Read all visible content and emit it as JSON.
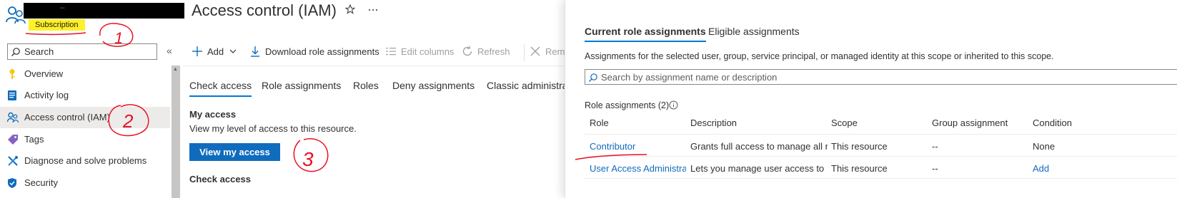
{
  "header": {
    "title": "Access control (IAM)",
    "redacted_text": "--",
    "resource_type": "Subscription",
    "favorite_icon": "star-icon",
    "more_icon": "ellipsis-icon"
  },
  "sidebar": {
    "search_placeholder": "Search",
    "collapse_glyph": "«",
    "items": [
      {
        "label": "Overview",
        "icon": "key-icon"
      },
      {
        "label": "Activity log",
        "icon": "activity-log-icon"
      },
      {
        "label": "Access control (IAM)",
        "icon": "people-icon",
        "active": true
      },
      {
        "label": "Tags",
        "icon": "tag-icon"
      },
      {
        "label": "Diagnose and solve problems",
        "icon": "wrench-icon"
      },
      {
        "label": "Security",
        "icon": "shield-icon"
      }
    ]
  },
  "toolbar": {
    "add": "Add",
    "download": "Download role assignments",
    "edit_columns": "Edit columns",
    "refresh": "Refresh",
    "remove": "Remo"
  },
  "tabs": [
    "Check access",
    "Role assignments",
    "Roles",
    "Deny assignments",
    "Classic administrat"
  ],
  "check_access": {
    "my_access_heading": "My access",
    "my_access_desc": "View my level of access to this resource.",
    "view_button": "View my access",
    "check_access_heading": "Check access"
  },
  "panel": {
    "tabs": [
      "Current role assignments",
      "Eligible assignments"
    ],
    "description": "Assignments for the selected user, group, service principal, or managed identity at this scope or inherited to this scope.",
    "search_placeholder": "Search by assignment name or description",
    "count_label": "Role assignments (2)",
    "columns": [
      "Role",
      "Description",
      "Scope",
      "Group assignment",
      "Condition"
    ],
    "rows": [
      {
        "role": "Contributor",
        "description": "Grants full access to manage all r...",
        "scope": "This resource",
        "group": "--",
        "condition": "None"
      },
      {
        "role": "User Access Administrato",
        "description": "Lets you manage user access to ...",
        "scope": "This resource",
        "group": "--",
        "condition": "Add"
      }
    ]
  },
  "annotations": {
    "numbers": [
      "1",
      "2",
      "3"
    ],
    "color": "#e81123"
  },
  "colors": {
    "accent": "#0078d4",
    "primary_button": "#0f6cbd",
    "highlight": "#fff02a",
    "annotation": "#e81123"
  }
}
